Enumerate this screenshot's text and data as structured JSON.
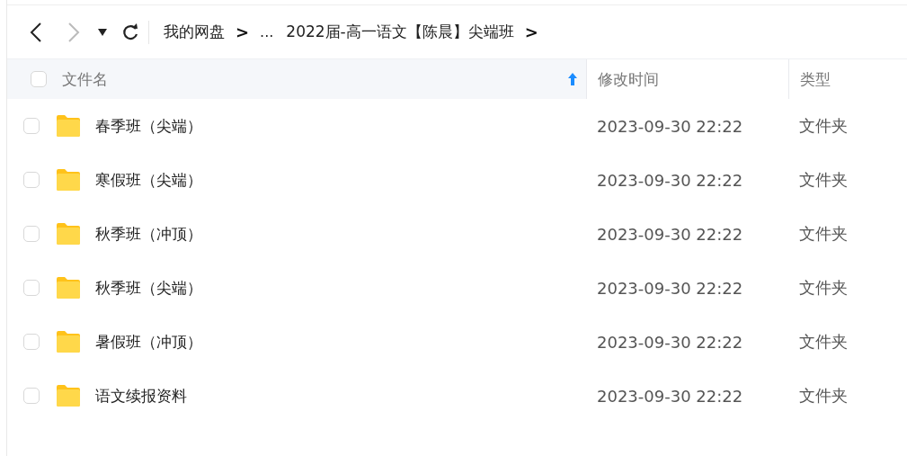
{
  "toolbar": {
    "back_disabled": false,
    "forward_disabled": true
  },
  "breadcrumb": [
    {
      "kind": "link",
      "label": "我的网盘"
    },
    {
      "kind": "separator",
      "label": ">"
    },
    {
      "kind": "ellipsis",
      "label": "..."
    },
    {
      "kind": "link",
      "label": "2022届-高一语文【陈晨】尖端班"
    },
    {
      "kind": "separator",
      "label": ">"
    }
  ],
  "table": {
    "select_all_checked": false,
    "columns": [
      {
        "label": "文件名",
        "sorted": true
      },
      {
        "label": "修改时间",
        "sorted": false
      },
      {
        "label": "类型",
        "sorted": false
      }
    ],
    "rows": [
      {
        "checked": false,
        "name": "春季班（尖端）",
        "modified": "2023-09-30 22:22",
        "type": "文件夹"
      },
      {
        "checked": false,
        "name": "寒假班（尖端）",
        "modified": "2023-09-30 22:22",
        "type": "文件夹"
      },
      {
        "checked": false,
        "name": "秋季班（冲顶）",
        "modified": "2023-09-30 22:22",
        "type": "文件夹"
      },
      {
        "checked": false,
        "name": "秋季班（尖端）",
        "modified": "2023-09-30 22:22",
        "type": "文件夹"
      },
      {
        "checked": false,
        "name": "暑假班（冲顶）",
        "modified": "2023-09-30 22:22",
        "type": "文件夹"
      },
      {
        "checked": false,
        "name": "语文续报资料",
        "modified": "2023-09-30 22:22",
        "type": "文件夹"
      }
    ]
  }
}
